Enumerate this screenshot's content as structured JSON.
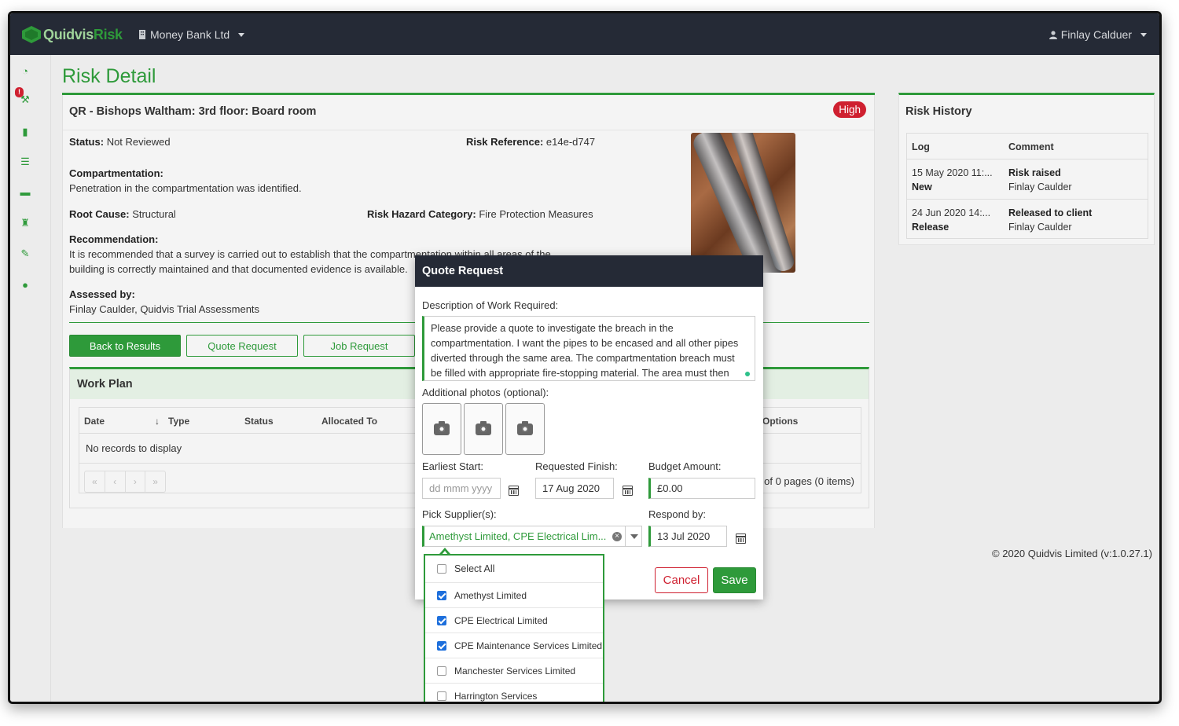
{
  "app": {
    "brand_q": "Quidvis",
    "brand_r": "Risk",
    "org": "Money Bank Ltd",
    "user": "Finlay Calduer"
  },
  "sidebar": {
    "badge": "!"
  },
  "page": {
    "title": "Risk Detail"
  },
  "risk": {
    "title": "QR - Bishops Waltham: 3rd floor: Board room",
    "priority": "High",
    "status_label": "Status:",
    "status_value": "Not Reviewed",
    "ref_label": "Risk Reference:",
    "ref_value": "e14e-d747",
    "compartmentation_label": "Compartmentation:",
    "compartmentation_value": "Penetration in the compartmentation was identified.",
    "root_cause_label": "Root Cause:",
    "root_cause_value": "Structural",
    "hazard_label": "Risk Hazard Category:",
    "hazard_value": "Fire Protection Measures",
    "recommendation_label": "Recommendation:",
    "recommendation_line1": "It is recommended that a survey is carried out to establish that the compartmentation within all areas of the",
    "recommendation_line2": "building is correctly maintained and that documented evidence is available.",
    "assessed_label": "Assessed by:",
    "assessed_value": "Finlay Caulder, Quidvis Trial Assessments"
  },
  "actions": {
    "back": "Back to Results",
    "quote": "Quote Request",
    "job": "Job Request"
  },
  "workplan": {
    "title": "Work Plan",
    "columns": [
      "Date",
      "Type",
      "Status",
      "Allocated To",
      "Options"
    ],
    "empty": "No records to display",
    "pager": [
      "«",
      "‹",
      "›",
      "»"
    ],
    "pages_info": "of 0 pages (0 items)"
  },
  "history": {
    "title": "Risk History",
    "columns": [
      "Log",
      "Comment"
    ],
    "rows": [
      {
        "log": "15 May 2020 11:...",
        "type": "New",
        "comment": "Risk raised",
        "by": "Finlay Caulder"
      },
      {
        "log": "24 Jun 2020 14:...",
        "type": "Release",
        "comment": "Released to client",
        "by": "Finlay Caulder"
      }
    ]
  },
  "footer": "© 2020 Quidvis Limited (v:1.0.27.1)",
  "modal": {
    "title": "Quote Request",
    "description_label": "Description of Work Required:",
    "description_lines": [
      "Please provide a quote to investigate the breach in the",
      "compartmentation. I want the pipes to be encased and all other pipes",
      "diverted through the same area. The compartmentation breach must",
      "be filled with appropriate fire-stopping material. The area must then"
    ],
    "photos_label": "Additional photos (optional):",
    "earliest_label": "Earliest Start:",
    "earliest_placeholder": "dd mmm yyyy",
    "finish_label": "Requested Finish:",
    "finish_value": "17 Aug 2020",
    "budget_label": "Budget Amount:",
    "budget_value": "£0.00",
    "supplier_label": "Pick Supplier(s):",
    "supplier_value": "Amethyst Limited, CPE Electrical Lim...",
    "respond_label": "Respond by:",
    "respond_value": "13 Jul 2020",
    "cancel": "Cancel",
    "save": "Save"
  },
  "supplier_dropdown": {
    "items": [
      {
        "label": "Select All",
        "checked": false
      },
      {
        "label": "Amethyst Limited",
        "checked": true
      },
      {
        "label": "CPE Electrical Limited",
        "checked": true
      },
      {
        "label": "CPE Maintenance Services Limited",
        "checked": true
      },
      {
        "label": "Manchester Services Limited",
        "checked": false
      },
      {
        "label": "Harrington Services",
        "checked": false
      }
    ]
  },
  "colors": {
    "brand_green": "#2e9a3a",
    "topbar": "#252a36",
    "danger": "#cf2030",
    "checkbox_blue": "#1d6fdc"
  }
}
